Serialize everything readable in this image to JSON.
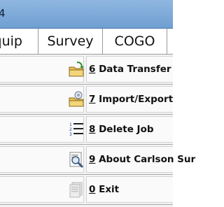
{
  "titlebar": {
    "title_fragment": "4"
  },
  "tabs": [
    {
      "label": "quip"
    },
    {
      "label": "Survey"
    },
    {
      "label": "COGO"
    },
    {
      "label": ""
    }
  ],
  "menu": {
    "items": [
      {
        "number": "6",
        "label": " Data Transfer",
        "icon": "data-transfer-icon"
      },
      {
        "number": "7",
        "label": " Import/Export",
        "icon": "import-export-icon"
      },
      {
        "number": "8",
        "label": " Delete Job",
        "icon": "delete-job-icon"
      },
      {
        "number": "9",
        "label": " About Carlson Sur",
        "icon": "about-icon"
      },
      {
        "number": "0",
        "label": " Exit",
        "icon": "exit-icon"
      }
    ]
  },
  "colors": {
    "titlebar": "#7ea9d9",
    "row_border": "#a8a8a8"
  }
}
